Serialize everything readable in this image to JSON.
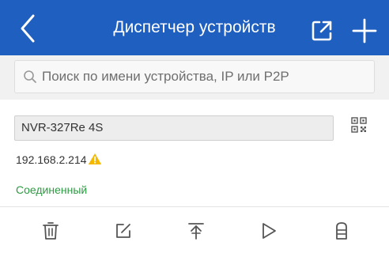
{
  "header": {
    "title": "Диспетчер устройств",
    "back_icon": "chevron-left-icon",
    "export_icon": "share-icon",
    "add_icon": "plus-icon",
    "background_color": "#1e5fbf"
  },
  "search": {
    "placeholder": "Поиск по имени устройства, IP или P2P",
    "value": ""
  },
  "device": {
    "name": "NVR-327Re 4S",
    "ip": "192.168.2.214",
    "status": "Соединенный",
    "status_color": "#2e9a43",
    "warning_icon": "warning-icon",
    "qr_icon": "qr-code-icon"
  },
  "toolbar": {
    "icons": [
      "trash-icon",
      "edit-icon",
      "upload-icon",
      "play-icon",
      "storage-icon"
    ]
  }
}
